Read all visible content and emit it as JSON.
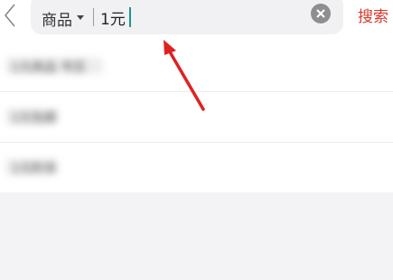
{
  "header": {
    "category_label": "商品",
    "query_value": "1元",
    "search_label": "搜索"
  },
  "suggestions": [
    {
      "label": "1元商品 专区"
    },
    {
      "label": "1元包邮"
    },
    {
      "label": "1元秒杀"
    }
  ],
  "colors": {
    "accent": "#d8392c",
    "caret": "#1a9a8a",
    "annotation_arrow": "#e02020"
  },
  "icons": {
    "back": "chevron-left-icon",
    "dropdown": "caret-down-icon",
    "clear": "clear-circle-x-icon"
  }
}
